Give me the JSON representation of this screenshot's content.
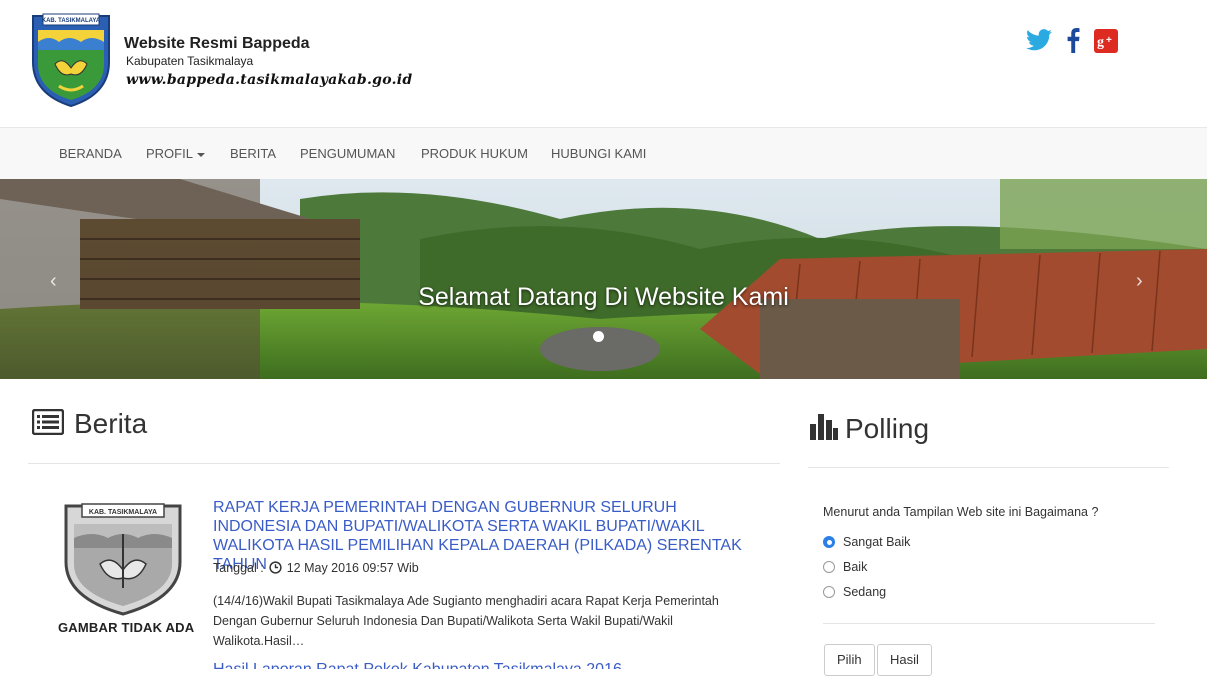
{
  "header": {
    "title": "Website Resmi Bappeda",
    "subtitle": "Kabupaten Tasikmalaya",
    "url": "www.bappeda.tasikmalayakab.go.id",
    "logo_label": "KAB. TASIKMALAYA",
    "social": [
      "twitter-icon",
      "facebook-icon",
      "google-plus-icon"
    ]
  },
  "nav": {
    "items": [
      "BERANDA",
      "PROFIL",
      "BERITA",
      "PENGUMUMAN",
      "PRODUK HUKUM",
      "HUBUNGI KAMI"
    ]
  },
  "carousel": {
    "caption": "Selamat Datang Di Website Kami",
    "prev": "‹",
    "next": "›"
  },
  "berita": {
    "heading": "Berita",
    "item": {
      "title": "RAPAT KERJA PEMERINTAH DENGAN GUBERNUR SELURUH INDONESIA DAN BUPATI/WALIKOTA SERTA WAKIL BUPATI/WAKIL WALIKOTA HASIL PEMILIHAN KEPALA DAERAH (PILKADA) SERENTAK TAHUN",
      "date_label": "Tanggal :",
      "date": "12 May 2016 09:57 Wib",
      "excerpt": "(14/4/16)Wakil Bupati Tasikmalaya Ade Sugianto menghadiri acara Rapat Kerja Pemerintah Dengan Gubernur Seluruh Indonesia Dan Bupati/Walikota Serta Wakil Bupati/Wakil Walikota.Hasil…",
      "thumb_caption": "GAMBAR TIDAK ADA",
      "thumb_label": "KAB. TASIKMALAYA"
    },
    "next_item_title": "Hasil Laporan Rapat Pokok Kabupaten Tasikmalaya 2016"
  },
  "polling": {
    "heading": "Polling",
    "question": "Menurut anda Tampilan Web site ini Bagaimana ?",
    "options": [
      "Sangat Baik",
      "Baik",
      "Sedang"
    ],
    "selected": "Sangat Baik",
    "vote_button": "Pilih",
    "result_button": "Hasil"
  },
  "colors": {
    "link": "#3a5cc6",
    "twitter": "#2ba9e1",
    "facebook": "#1b4a9c",
    "google_plus": "#dd2b22",
    "radio_checked": "#2b80e6"
  }
}
